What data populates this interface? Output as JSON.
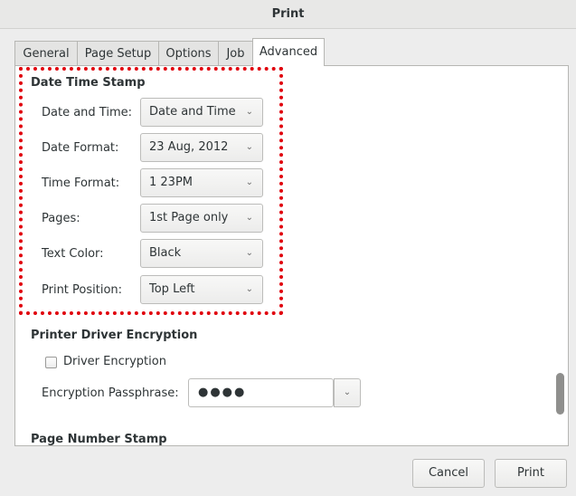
{
  "window": {
    "title": "Print"
  },
  "tabs": [
    {
      "label": "General"
    },
    {
      "label": "Page Setup"
    },
    {
      "label": "Options"
    },
    {
      "label": "Job"
    },
    {
      "label": "Advanced"
    }
  ],
  "date_time_stamp": {
    "title": "Date Time Stamp",
    "rows": [
      {
        "label": "Date and Time:",
        "value": "Date and Time"
      },
      {
        "label": "Date Format:",
        "value": "23 Aug, 2012"
      },
      {
        "label": "Time Format:",
        "value": "1 23PM"
      },
      {
        "label": "Pages:",
        "value": "1st Page only"
      },
      {
        "label": "Text Color:",
        "value": "Black"
      },
      {
        "label": "Print Position:",
        "value": "Top Left"
      }
    ]
  },
  "encryption": {
    "title": "Printer Driver Encryption",
    "checkbox_label": "Driver Encryption",
    "passphrase_label": "Encryption Passphrase:",
    "passphrase_value": "●●●●"
  },
  "page_number_stamp": {
    "title": "Page Number Stamp"
  },
  "buttons": {
    "cancel": "Cancel",
    "print": "Print"
  },
  "icons": {
    "combo_arrow": "chevron-down-icon"
  },
  "colors": {
    "highlight": "#e0000b"
  }
}
